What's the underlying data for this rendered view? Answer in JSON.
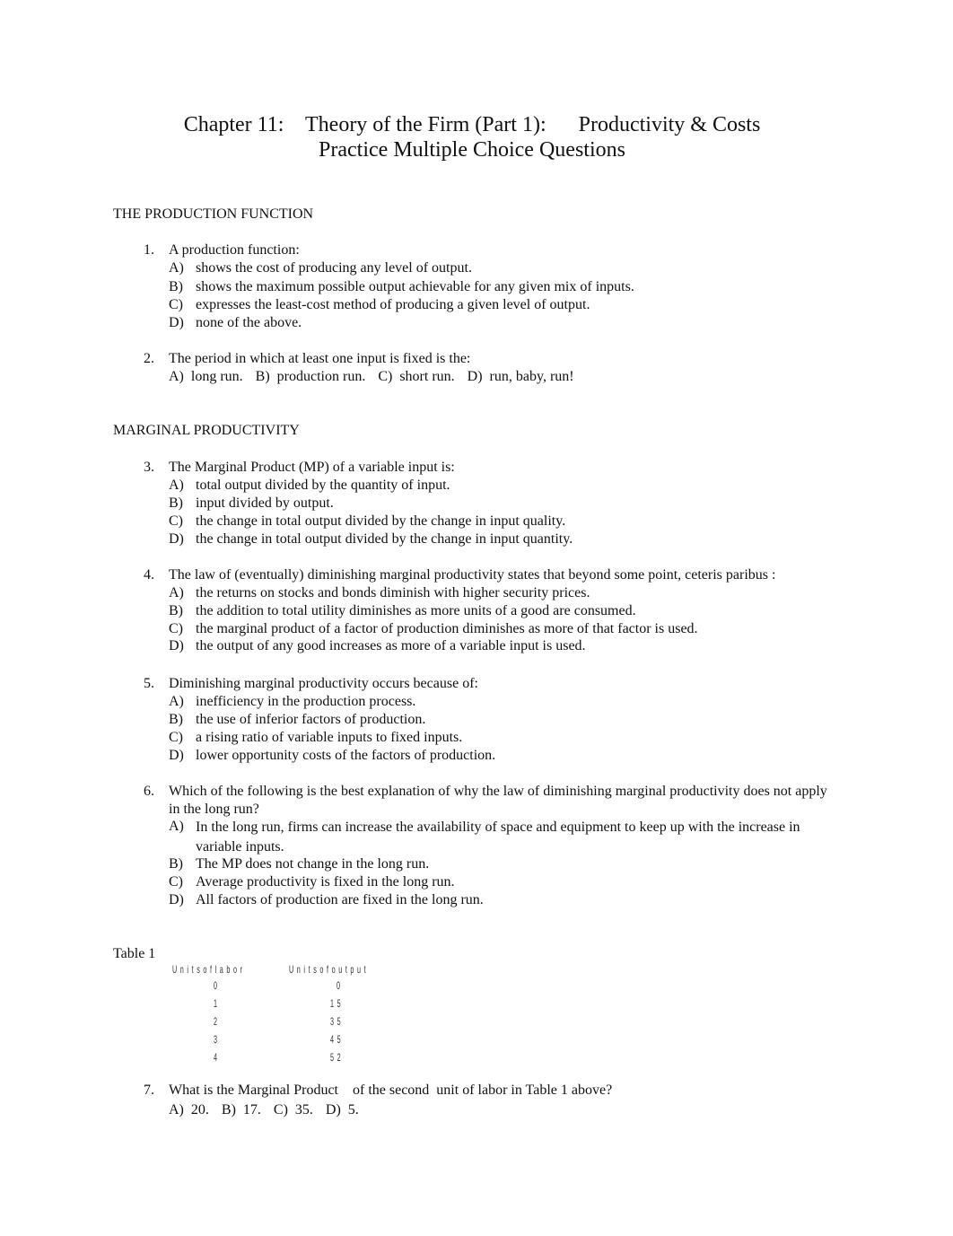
{
  "document": {
    "title_line1": "Chapter 11:    Theory of the Firm (Part 1):      Productivity & Costs",
    "title_line2": "Practice Multiple Choice Questions"
  },
  "sections": [
    {
      "heading": "THE PRODUCTION FUNCTION"
    },
    {
      "heading": "MARGINAL PRODUCTIVITY"
    }
  ],
  "questions": [
    {
      "number": "1.",
      "text": "A production function:",
      "options": [
        {
          "letter": "A)",
          "text": "shows the cost of producing any level of output."
        },
        {
          "letter": "B)",
          "text": "shows the maximum possible output achievable for any given mix of inputs."
        },
        {
          "letter": "C)",
          "text": "expresses the least-cost method of producing a given level of output."
        },
        {
          "letter": "D)",
          "text": "none of the above."
        }
      ]
    },
    {
      "number": "2.",
      "text": "The period in which at least one input is fixed is the:",
      "options": [
        {
          "letter": "A)",
          "text": "long run."
        },
        {
          "letter": "B)",
          "text": "production run."
        },
        {
          "letter": "C)",
          "text": "short run."
        },
        {
          "letter": "D)",
          "text": "run, baby, run!"
        }
      ]
    },
    {
      "number": "3.",
      "text": "The Marginal Product (MP) of a variable input is:",
      "options": [
        {
          "letter": "A)",
          "text": "total output divided by the quantity of input."
        },
        {
          "letter": "B)",
          "text": "input divided by output."
        },
        {
          "letter": "C)",
          "text": "the change in total output divided by the change in input quality."
        },
        {
          "letter": "D)",
          "text": "the change in total output divided by the change in input quantity."
        }
      ]
    },
    {
      "number": "4.",
      "text": "The law of (eventually) diminishing marginal productivity states that beyond some point, ceteris paribus :",
      "options": [
        {
          "letter": "A)",
          "text": "the returns on stocks and bonds diminish with higher security prices."
        },
        {
          "letter": "B)",
          "text": "the addition to total utility diminishes as more units of a good are consumed."
        },
        {
          "letter": "C)",
          "text": "the marginal product of a factor of production diminishes as more of that factor is used."
        },
        {
          "letter": "D)",
          "text": "the output of any good increases as more of a variable input is used."
        }
      ]
    },
    {
      "number": "5.",
      "text": "Diminishing marginal productivity occurs because of:",
      "options": [
        {
          "letter": "A)",
          "text": "inefficiency in the production process."
        },
        {
          "letter": "B)",
          "text": "the use of inferior factors of production."
        },
        {
          "letter": "C)",
          "text": "a rising ratio of variable inputs to fixed inputs."
        },
        {
          "letter": "D)",
          "text": "lower opportunity costs of the factors of production."
        }
      ]
    },
    {
      "number": "6.",
      "text": "Which of the following is the best explanation of why the law of diminishing marginal productivity does not apply in the long run?",
      "options": [
        {
          "letter": "A)",
          "text": "In the long run, firms can increase the availability of space and equipment to keep up with the increase in variable inputs."
        },
        {
          "letter": "B)",
          "text": "The MP does not change in the long run."
        },
        {
          "letter": "C)",
          "text": "Average productivity is fixed in the long run."
        },
        {
          "letter": "D)",
          "text": "All factors of production are fixed in the long run."
        }
      ]
    },
    {
      "number": "7.",
      "text": "What is the Marginal Product    of the second  unit of labor in Table 1 above?",
      "options": [
        {
          "letter": "A)",
          "text": "20."
        },
        {
          "letter": "B)",
          "text": "17."
        },
        {
          "letter": "C)",
          "text": "35."
        },
        {
          "letter": "D)",
          "text": "5."
        }
      ]
    }
  ],
  "table1": {
    "label": "Table 1",
    "headers": [
      "Unitsoflabor",
      "Unitsofoutput"
    ],
    "rows": [
      [
        "0",
        "0"
      ],
      [
        "1",
        "15"
      ],
      [
        "2",
        "35"
      ],
      [
        "3",
        "45"
      ],
      [
        "4",
        "52"
      ]
    ]
  }
}
